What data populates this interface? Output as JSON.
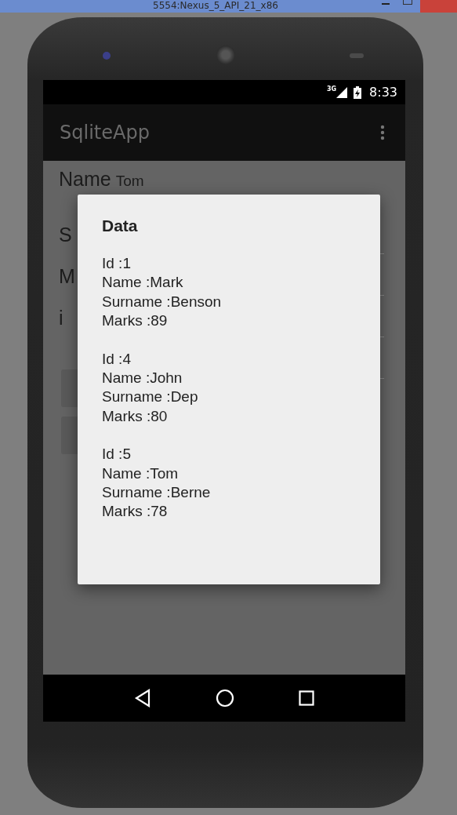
{
  "window": {
    "title": "5554:Nexus_5_API_21_x86"
  },
  "status_bar": {
    "network": "3G",
    "time": "8:33"
  },
  "app_bar": {
    "title": "SqliteApp"
  },
  "form": {
    "fields": [
      {
        "label": "Name",
        "value": "Tom"
      },
      {
        "label": "S"
      },
      {
        "label": "M"
      },
      {
        "label": "i"
      }
    ]
  },
  "dialog": {
    "title": "Data",
    "records": [
      {
        "lines": [
          "Id :1",
          "Name :Mark",
          "Surname :Benson",
          "Marks :89"
        ]
      },
      {
        "lines": [
          "Id :4",
          "Name :John",
          "Surname :Dep",
          "Marks :80"
        ]
      },
      {
        "lines": [
          "Id :5",
          "Name :Tom",
          "Surname :Berne",
          "Marks :78"
        ]
      }
    ]
  }
}
